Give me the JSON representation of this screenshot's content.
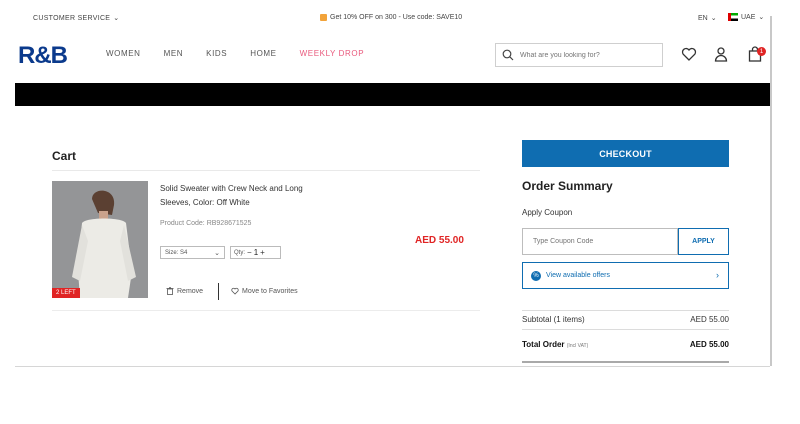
{
  "topbar": {
    "customer_service": "CUSTOMER SERVICE",
    "promo": "Get 10% OFF on 300 - Use code: SAVE10",
    "language": "EN",
    "country": "UAE"
  },
  "header": {
    "logo": "R&B",
    "nav": [
      "WOMEN",
      "MEN",
      "KIDS",
      "HOME",
      "WEEKLY DROP"
    ],
    "search_placeholder": "What are you looking for?",
    "bag_count": "1"
  },
  "cart": {
    "title": "Cart",
    "item": {
      "name": "Solid Sweater with Crew Neck and Long Sleeves, Color: Off White",
      "product_code": "Product Code: RB928671525",
      "size": "Size: S4",
      "qty_label": "Qty:",
      "qty_minus": "−",
      "qty": "1",
      "qty_plus": "+",
      "price": "AED 55.00",
      "stock_tag": "2 LEFT",
      "remove": "Remove",
      "favorite": "Move to Favorites"
    }
  },
  "summary": {
    "checkout": "CHECKOUT",
    "title": "Order Summary",
    "apply_coupon": "Apply Coupon",
    "coupon_placeholder": "Type Coupon Code",
    "apply": "APPLY",
    "offers": "View available offers",
    "subtotal_label": "Subtotal (1 items)",
    "subtotal_value": "AED 55.00",
    "total_label": "Total Order",
    "total_vat": "(Incl VAT)",
    "total_value": "AED 55.00"
  },
  "colors": {
    "brand": "#0b3a8c",
    "accent": "#0f6db1",
    "price": "#e02424",
    "weekly_drop": "#e95a7d"
  }
}
